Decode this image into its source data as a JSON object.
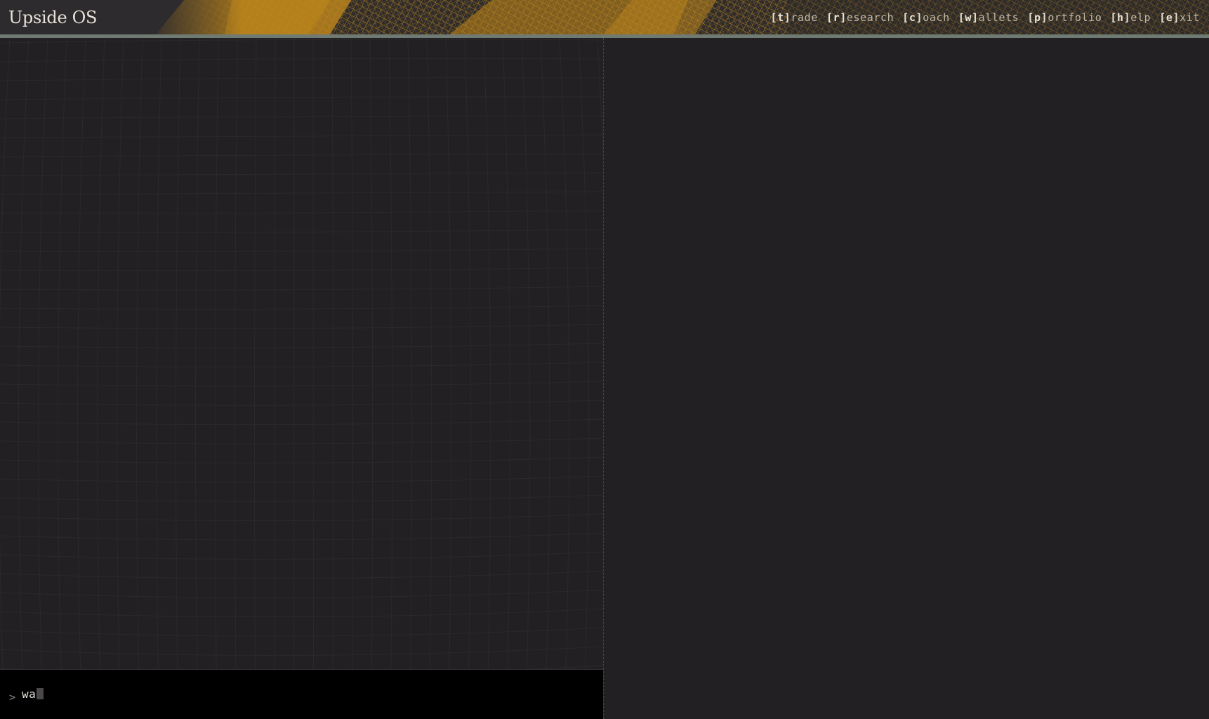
{
  "app": {
    "title": "Upside OS"
  },
  "nav": {
    "items": [
      {
        "key": "[t]",
        "rest": "rade"
      },
      {
        "key": "[r]",
        "rest": "esearch"
      },
      {
        "key": "[c]",
        "rest": "oach"
      },
      {
        "key": "[w]",
        "rest": "allets"
      },
      {
        "key": "[p]",
        "rest": "ortfolio"
      },
      {
        "key": "[h]",
        "rest": "elp"
      },
      {
        "key": "[e]",
        "rest": "xit"
      }
    ]
  },
  "command": {
    "prompt": ">",
    "value": "wa"
  },
  "colors": {
    "background": "#222022",
    "header_accent": "#c08a1e",
    "header_rule": "#6f7a73",
    "command_bar": "#000000",
    "text_primary": "#e6e2d8"
  }
}
